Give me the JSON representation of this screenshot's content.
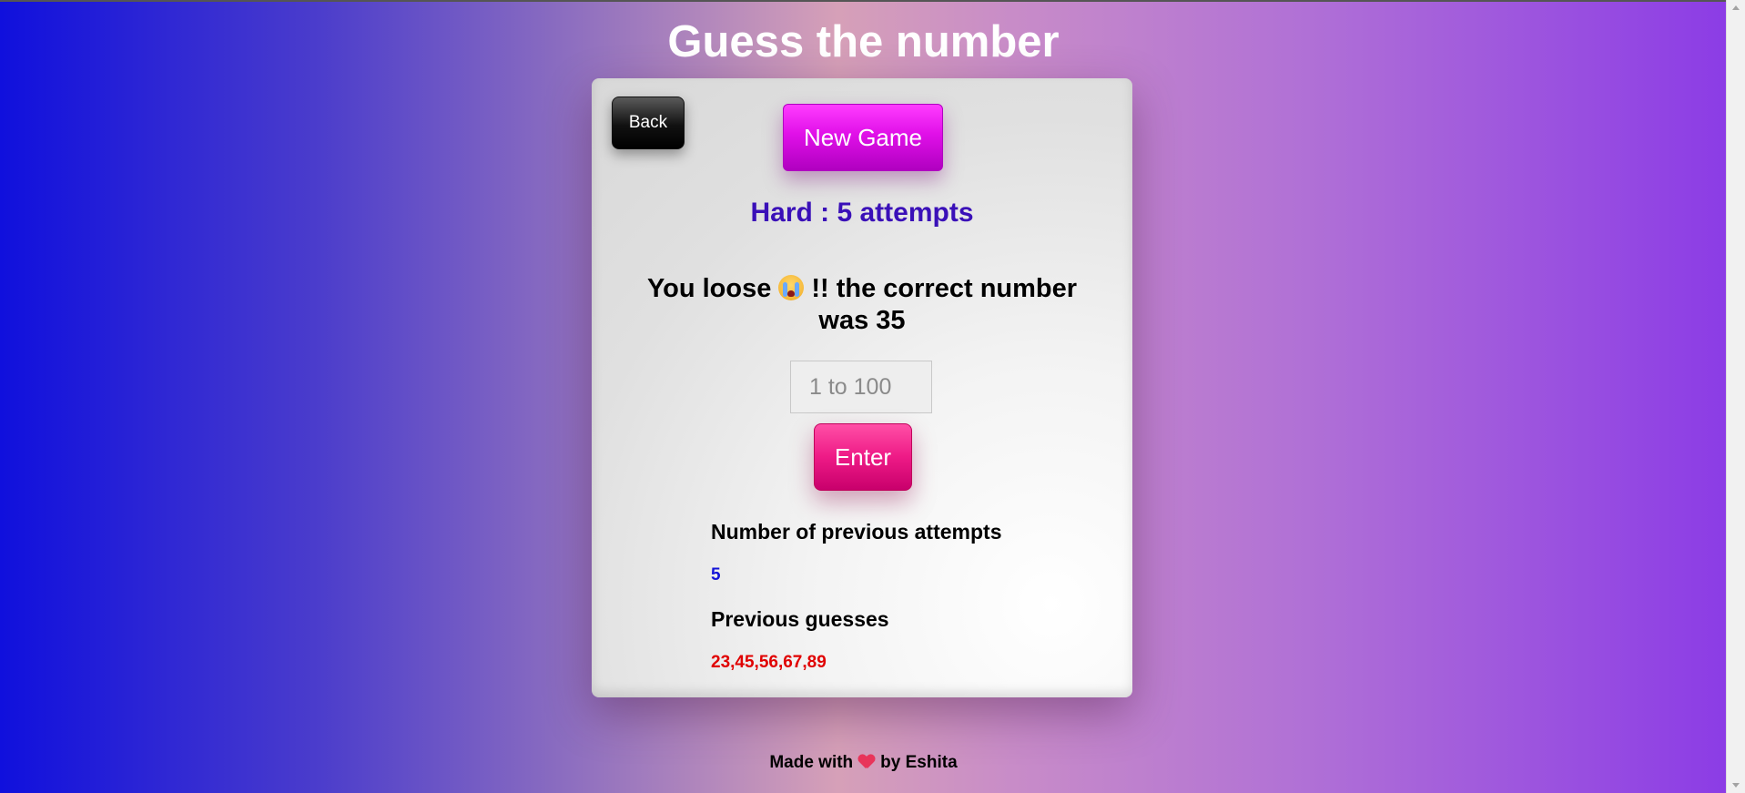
{
  "header": {
    "title": "Guess the number"
  },
  "card": {
    "back_label": "Back",
    "new_game_label": "New Game",
    "difficulty_text": "Hard : 5 attempts",
    "result_prefix": "You loose",
    "result_suffix": "!! the correct number was 35",
    "result_emoji": "loudly-crying-face-icon",
    "input_placeholder": "1 to 100",
    "input_value": "",
    "enter_label": "Enter",
    "attempts_heading": "Number of previous attempts",
    "attempts_value": "5",
    "guesses_heading": "Previous guesses",
    "guesses_value": "23,45,56,67,89"
  },
  "footer": {
    "prefix": "Made with",
    "icon": "heart-icon",
    "suffix": "by Eshita"
  },
  "colors": {
    "difficulty": "#3a10b8",
    "attempts_value": "#1414d8",
    "guesses_value": "#e00000",
    "new_game_button": "#e010e8",
    "enter_button": "#ee1a86"
  }
}
